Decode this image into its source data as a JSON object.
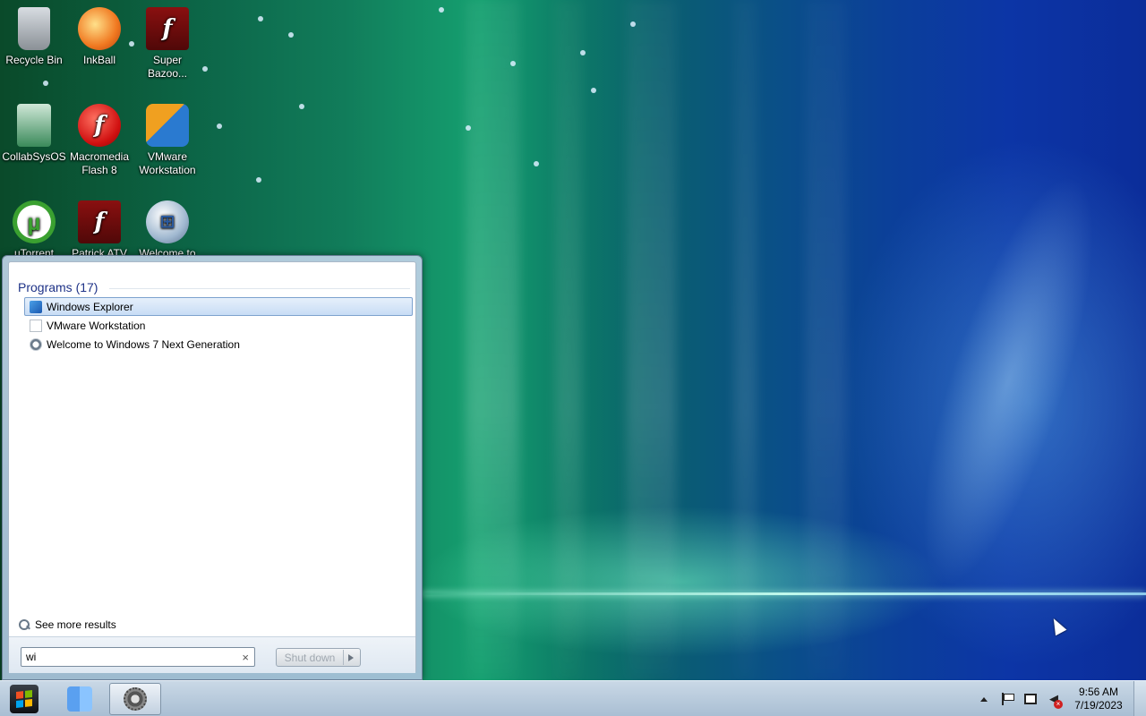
{
  "desktop": {
    "icons": [
      {
        "label": "Recycle Bin",
        "icon": "recycle-bin-icon"
      },
      {
        "label": "InkBall",
        "icon": "inkball-icon"
      },
      {
        "label": "Super Bazoo...",
        "icon": "flash-icon"
      },
      {
        "label": "CollabSysOS",
        "icon": "collabsysos-icon"
      },
      {
        "label": "Macromedia Flash 8",
        "icon": "macromedia-flash-icon"
      },
      {
        "label": "VMware Workstation",
        "icon": "vmware-icon"
      },
      {
        "label": "uTorrent",
        "icon": "utorrent-icon"
      },
      {
        "label": "Patrick ATV",
        "icon": "flash-icon"
      },
      {
        "label": "Welcome to",
        "icon": "windows-orb-icon"
      }
    ]
  },
  "start_menu": {
    "section_title": "Programs (17)",
    "programs": [
      {
        "label": "Windows Explorer",
        "icon": "windows-explorer-icon",
        "selected": true
      },
      {
        "label": "VMware Workstation",
        "icon": "blank-document-icon",
        "selected": false
      },
      {
        "label": "Welcome to Windows 7 Next Generation",
        "icon": "welcome-icon",
        "selected": false
      }
    ],
    "see_more": "See more results",
    "search_value": "wi",
    "clear_glyph": "×",
    "shutdown_label": "Shut down"
  },
  "taskbar": {
    "clock_time": "9:56 AM",
    "clock_date": "7/19/2023"
  },
  "colors": {
    "section_title": "#1e3287",
    "selection_border": "#7da2ce"
  }
}
